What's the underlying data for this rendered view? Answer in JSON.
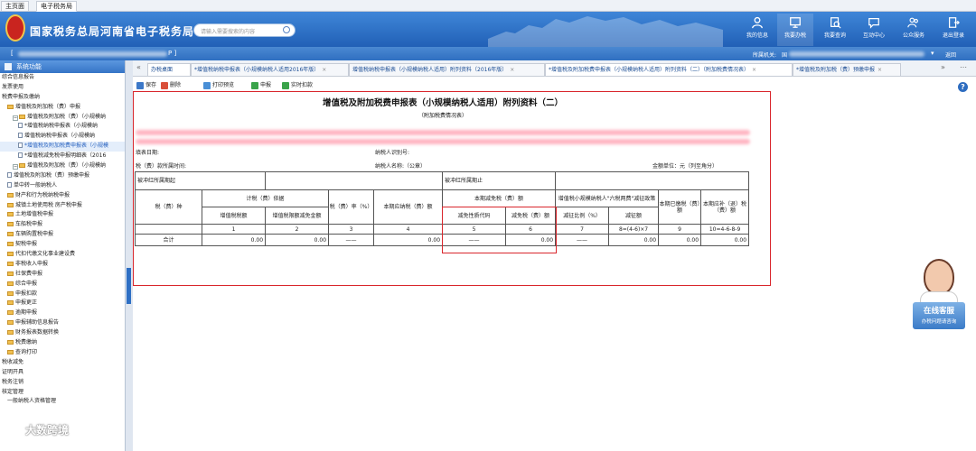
{
  "topbar": {
    "tabs": [
      "主页面",
      "电子税务局"
    ]
  },
  "header": {
    "title": "国家税务总局河南省电子税务局",
    "search_placeholder": "请输入需要搜索的内容",
    "buttons": [
      "我的信息",
      "我要办税",
      "我要查询",
      "互动中心",
      "公众服务",
      "退出登录"
    ]
  },
  "strip": {
    "left_text": "[",
    "right_text": "P ]",
    "org_label": "所属机关:",
    "org_value": "国",
    "return_label": "返回"
  },
  "sidebar": {
    "header": "系统功能",
    "items": [
      "综合信息报告",
      "发票使用",
      "税费申报及缴纳",
      "增值税及附加税（费）申报",
      "增值税及附加税（费）（小规模纳",
      "*增值税纳税申报表（小规模纳",
      "增值税纳税申报表（小规模纳",
      "*增值税及附加税费申报表（小规模",
      "*增值税减免税申报明细表（2016",
      "增值税及附加税（费）（小规模纳",
      "增值税及附加税（费）预缴申报",
      "单中转一般纳税人",
      "财产和行为税纳税申报",
      "城镇土地使用税 房产税申报",
      "土地增值税申报",
      "车船税申报",
      "车辆购置税申报",
      "契税申报",
      "代扣代缴文化事业建设费",
      "非税收入申报",
      "社保费申报",
      "综合申报",
      "申报扣款",
      "申报更正",
      "逾期申报",
      "申报辅助信息报告",
      "财务报表数据转换",
      "税费缴纳",
      "查询打印",
      "税收减免",
      "证明开具",
      "税务注销",
      "核定管理",
      "一般纳税人资格管理"
    ]
  },
  "tabs": {
    "items": [
      {
        "label": "办税桌面",
        "close": ""
      },
      {
        "label": "*增值税纳税申报表（小规模纳税人适用2016年版）",
        "close": "×"
      },
      {
        "label": "增值税纳税申报表（小规模纳税人适用）附列资料（2016年版）",
        "close": "×"
      },
      {
        "label": "*增值税及附加税费申报表（小规模纳税人适用）附列资料（二）（附加税费情况表）",
        "close": "×"
      },
      {
        "label": "*增值税及附加税（费）预缴申报",
        "close": "×"
      }
    ],
    "prev": "«",
    "next": "»",
    "more": "⋯"
  },
  "toolbar": {
    "buttons": [
      "保存",
      "删除",
      "打印预览",
      "申报",
      "实时扣款"
    ]
  },
  "form": {
    "title": "增值税及附加税费申报表（小规模纳税人适用）附列资料（二）",
    "subtitle": "（附加税费情况表）",
    "fill_date_label": "填表日期:",
    "taxpayer_id_label": "纳税人识别号:",
    "period_label": "税（费）款所属时间:",
    "taxpayer_name_label": "纳税人名称:（公章）",
    "unit_label": "金额单位：元（列至角分）",
    "table": {
      "offset_start_label": "被冲红所属期起",
      "offset_end_label": "被冲红所属期止",
      "tax_type_header": "税（费）种",
      "basis_header": "计税（费）依据",
      "vat_amount_header": "增值税税额",
      "vat_reduction_header": "增值税限额减免金额",
      "rate_header": "税（费）率（%）",
      "payable_header": "本期应纳税（费）额",
      "reduction_header": "本期减免税（费）额",
      "reduction_code_header": "减免性质代码",
      "reduction_amount_header": "减免税（费）额",
      "six_tax_header": "增值税小规模纳税人\"六税两费\"减征政策",
      "six_ratio_header": "减征比例（%）",
      "six_amount_header": "减征额",
      "prepaid_header": "本期已缴税（费）额",
      "refund_header": "本期应补（退）税（费）额",
      "col_numbers": [
        "1",
        "2",
        "3",
        "4",
        "5",
        "6",
        "7",
        "8=(4-6)×7",
        "9",
        "10=4-6-8-9"
      ],
      "total_label": "合计",
      "total_values": [
        "0.00",
        "0.00",
        "——",
        "0.00",
        "——",
        "0.00",
        "——",
        "0.00",
        "0.00",
        "0.00"
      ]
    }
  },
  "kefu": {
    "title": "在线客服",
    "subtitle": "办税问题请咨询"
  },
  "watermark": "大数跨境"
}
